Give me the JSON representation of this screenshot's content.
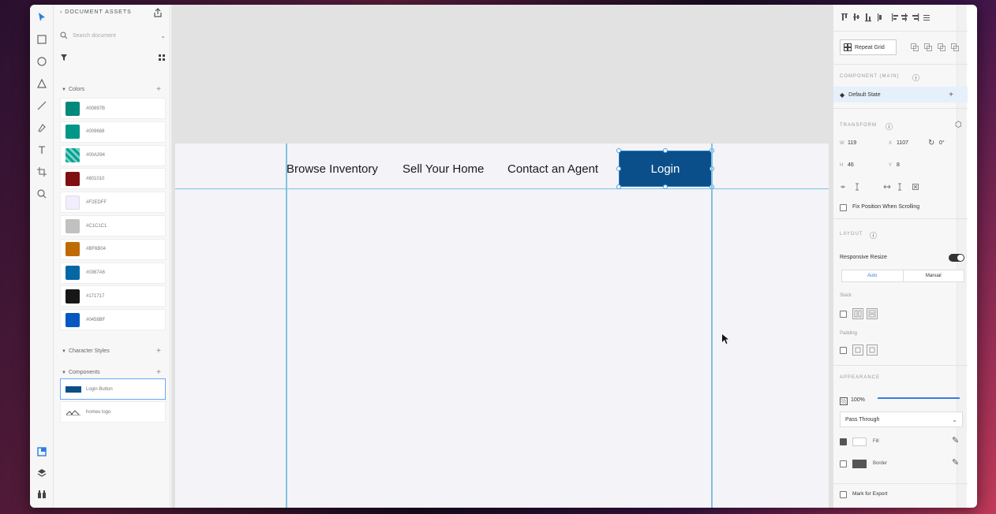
{
  "assets": {
    "title": "DOCUMENT ASSETS",
    "search_placeholder": "Search document",
    "colors_header": "Colors",
    "colors": [
      {
        "hex": "#00897B",
        "label": "#00897B"
      },
      {
        "hex": "#009688",
        "label": "#009688"
      },
      {
        "hex": "#00A394",
        "label": "#00A394"
      },
      {
        "hex": "#801010",
        "label": "#801010"
      },
      {
        "hex": "#F2EDFF",
        "label": "#F2EDFF"
      },
      {
        "hex": "#C1C1C1",
        "label": "#C1C1C1"
      },
      {
        "hex": "#BF6B04",
        "label": "#BF6B04"
      },
      {
        "hex": "#0367A6",
        "label": "#0367A6"
      },
      {
        "hex": "#171717",
        "label": "#171717"
      },
      {
        "hex": "#0458BF",
        "label": "#0458BF"
      }
    ],
    "character_styles_header": "Character Styles",
    "components_header": "Components",
    "components": [
      {
        "label": "Login Button"
      },
      {
        "label": "homeu logo"
      }
    ]
  },
  "canvas": {
    "nav_links": [
      "Browse Inventory",
      "Sell Your Home",
      "Contact an Agent"
    ],
    "login_label": "Login"
  },
  "inspector": {
    "repeat_grid": "Repeat Grid",
    "component_label": "COMPONENT (MAIN)",
    "default_state": "Default State",
    "transform_label": "TRANSFORM",
    "w_label": "W",
    "w_value": "119",
    "x_label": "X",
    "x_value": "1107",
    "rotation": "0°",
    "h_label": "H",
    "h_value": "46",
    "y_label": "Y",
    "y_value": "8",
    "fix_position": "Fix Position When Scrolling",
    "layout_label": "LAYOUT",
    "responsive_resize": "Responsive Resize",
    "seg_auto": "Auto",
    "seg_manual": "Manual",
    "stack_label": "Stack",
    "padding_label": "Padding",
    "appearance_label": "APPEARANCE",
    "opacity": "100%",
    "opacity_fraction": 1.0,
    "blend_mode": "Pass Through",
    "fill_label": "Fill",
    "border_label": "Border",
    "mark_export": "Mark for Export"
  },
  "colors": {
    "accent": "#3b7ae0",
    "login_bg": "#0b4f8a",
    "guide": "#7fc3e0"
  }
}
